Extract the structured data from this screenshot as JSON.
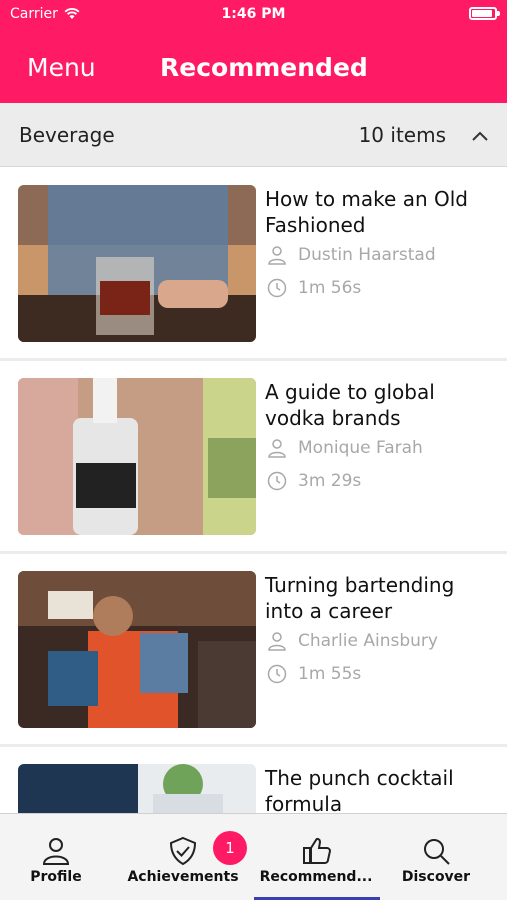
{
  "status": {
    "carrier": "Carrier",
    "time": "1:46 PM"
  },
  "nav": {
    "menu_label": "Menu",
    "title": "Recommended"
  },
  "section": {
    "title": "Beverage",
    "count": "10  items"
  },
  "items": [
    {
      "title": "How to make an Old Fashioned",
      "author": "Dustin Haarstad",
      "duration": "1m 56s"
    },
    {
      "title": "A guide to global vodka brands",
      "author": "Monique Farah",
      "duration": "3m 29s"
    },
    {
      "title": "Turning bartending into a career",
      "author": "Charlie Ainsbury",
      "duration": "1m 55s"
    },
    {
      "title": "The punch cocktail formula",
      "author": "",
      "duration": ""
    }
  ],
  "tabs": [
    {
      "label": "Profile",
      "icon": "person-icon"
    },
    {
      "label": "Achievements",
      "icon": "shield-check-icon",
      "badge": "1"
    },
    {
      "label": "Recommend...",
      "icon": "thumbs-up-icon"
    },
    {
      "label": "Discover",
      "icon": "search-icon"
    }
  ],
  "colors": {
    "accent": "#ff1a66",
    "tab_indicator": "#3a3fb0",
    "section_bg": "#ececec"
  }
}
